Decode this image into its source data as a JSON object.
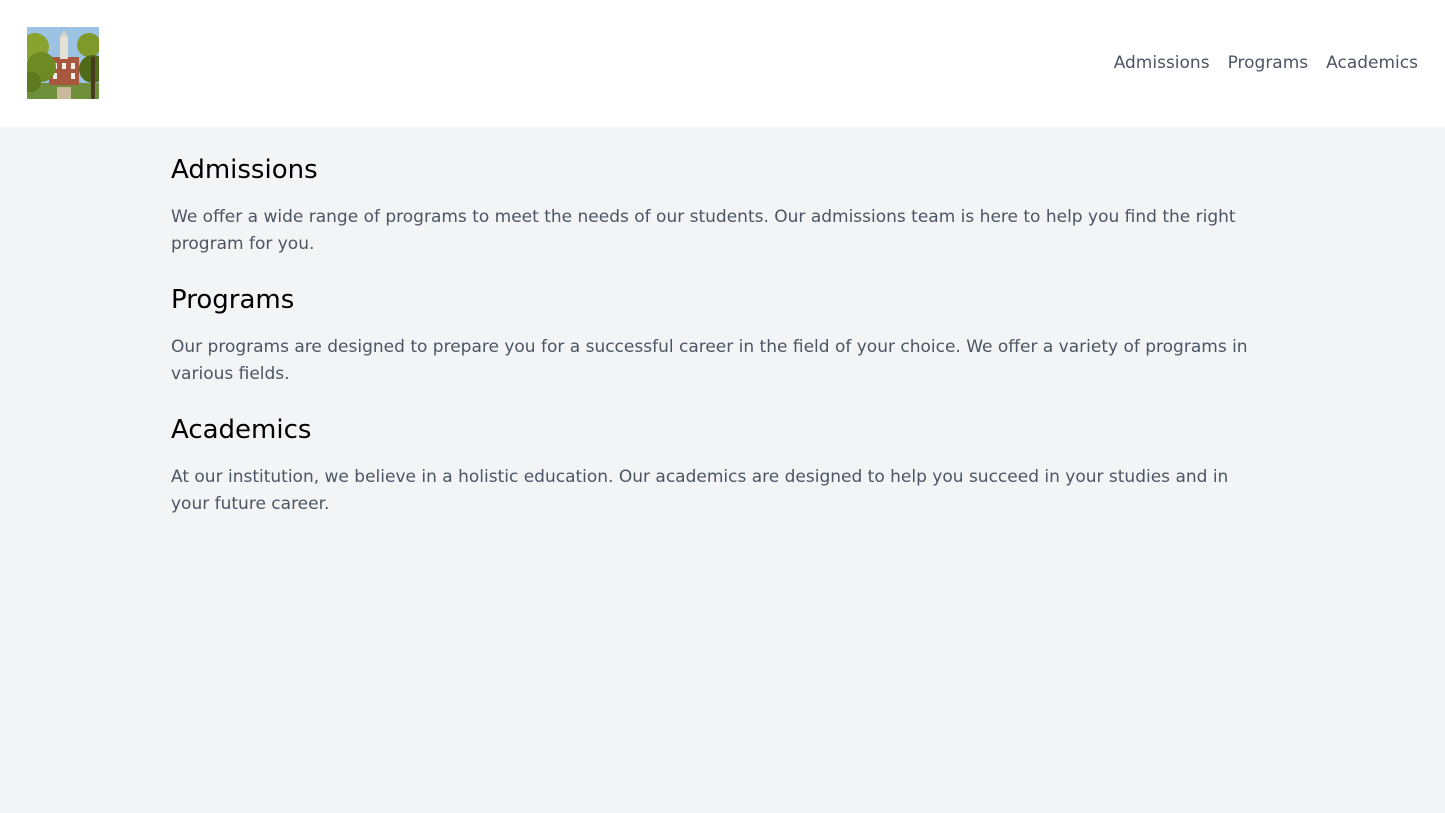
{
  "nav": {
    "items": [
      {
        "label": "Admissions"
      },
      {
        "label": "Programs"
      },
      {
        "label": "Academics"
      }
    ]
  },
  "sections": [
    {
      "title": "Admissions",
      "body": "We offer a wide range of programs to meet the needs of our students. Our admissions team is here to help you find the right program for you."
    },
    {
      "title": "Programs",
      "body": "Our programs are designed to prepare you for a successful career in the field of your choice. We offer a variety of programs in various fields."
    },
    {
      "title": "Academics",
      "body": "At our institution, we believe in a holistic education. Our academics are designed to help you succeed in your studies and in your future career."
    }
  ],
  "colors": {
    "page_bg": "#f3f4f6",
    "header_bg": "#ffffff",
    "nav_text": "#4b5563",
    "heading_text": "#000000",
    "body_text": "#4b5563"
  }
}
